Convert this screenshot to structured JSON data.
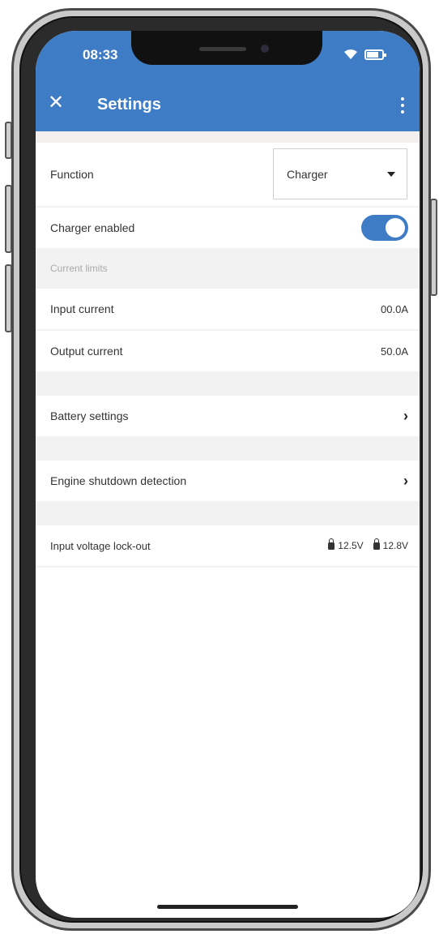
{
  "status_bar": {
    "time": "08:33"
  },
  "app_bar": {
    "title": "Settings"
  },
  "function_row": {
    "label": "Function",
    "dropdown_value": "Charger"
  },
  "charger_row": {
    "label": "Charger enabled",
    "enabled": true
  },
  "current_limits": {
    "header": "Current limits",
    "input": {
      "label": "Input current",
      "value": "00.0A"
    },
    "output": {
      "label": "Output current",
      "value": "50.0A"
    }
  },
  "battery_settings": {
    "label": "Battery settings"
  },
  "engine_shutdown": {
    "label": "Engine shutdown detection"
  },
  "input_voltage_lockout": {
    "label": "Input voltage lock-out",
    "value_1": "12.5V",
    "value_2": "12.8V"
  },
  "colors": {
    "accent": "#3f7cc6",
    "background_gap": "#f2f2f2"
  }
}
